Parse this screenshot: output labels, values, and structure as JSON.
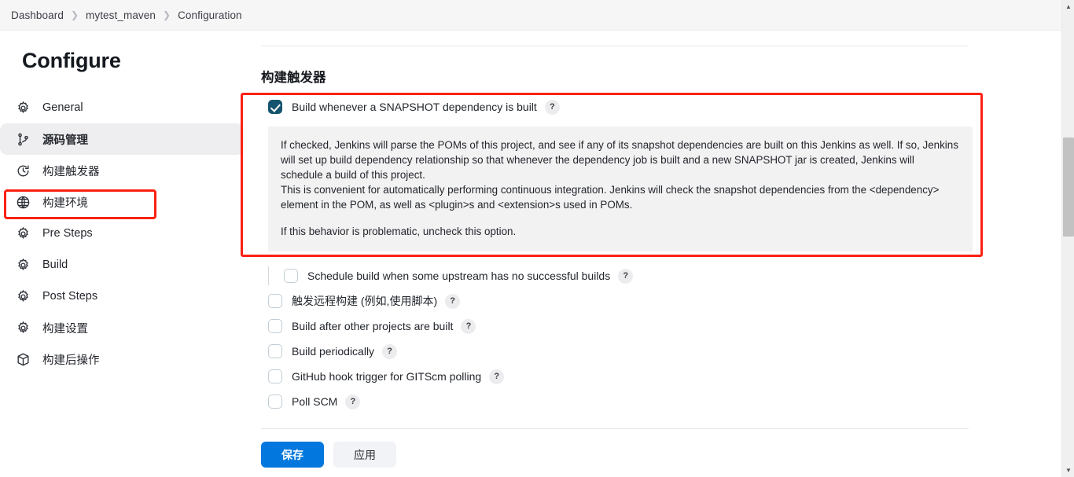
{
  "breadcrumb": {
    "items": [
      {
        "label": "Dashboard"
      },
      {
        "label": "mytest_maven"
      },
      {
        "label": "Configuration"
      }
    ],
    "separator": "❯"
  },
  "sidebar": {
    "title": "Configure",
    "items": [
      {
        "label": "General",
        "icon": "gear-icon",
        "active": false
      },
      {
        "label": "源码管理",
        "icon": "source-branch-icon",
        "active": true
      },
      {
        "label": "构建触发器",
        "icon": "clock-icon",
        "active": false
      },
      {
        "label": "构建环境",
        "icon": "globe-icon",
        "active": false
      },
      {
        "label": "Pre Steps",
        "icon": "gear-icon",
        "active": false
      },
      {
        "label": "Build",
        "icon": "gear-icon",
        "active": false
      },
      {
        "label": "Post Steps",
        "icon": "gear-icon",
        "active": false
      },
      {
        "label": "构建设置",
        "icon": "gear-icon",
        "active": false
      },
      {
        "label": "构建后操作",
        "icon": "box-icon",
        "active": false
      }
    ]
  },
  "main": {
    "section_title": "构建触发器",
    "primary_option": {
      "label": "Build whenever a SNAPSHOT dependency is built",
      "checked": true,
      "help": "?"
    },
    "description": {
      "paragraph1": "If checked, Jenkins will parse the POMs of this project, and see if any of its snapshot dependencies are built on this Jenkins as well. If so, Jenkins will set up build dependency relationship so that whenever the dependency job is built and a new SNAPSHOT jar is created, Jenkins will schedule a build of this project.",
      "paragraph2": "This is convenient for automatically performing continuous integration. Jenkins will check the snapshot dependencies from the <dependency> element in the POM, as well as <plugin>s and <extension>s used in POMs.",
      "paragraph3": "If this behavior is problematic, uncheck this option."
    },
    "options": [
      {
        "label": "Schedule build when some upstream has no successful builds",
        "checked": false,
        "indented": true,
        "help": "?"
      },
      {
        "label": "触发远程构建 (例如,使用脚本)",
        "checked": false,
        "indented": false,
        "help": "?"
      },
      {
        "label": "Build after other projects are built",
        "checked": false,
        "indented": false,
        "help": "?"
      },
      {
        "label": "Build periodically",
        "checked": false,
        "indented": false,
        "help": "?"
      },
      {
        "label": "GitHub hook trigger for GITScm polling",
        "checked": false,
        "indented": false,
        "help": "?"
      },
      {
        "label": "Poll SCM",
        "checked": false,
        "indented": false,
        "help": "?"
      }
    ],
    "buttons": {
      "save": "保存",
      "apply": "应用"
    }
  },
  "annotations": {
    "nav_highlight_color": "#fb2113",
    "block_highlight_color": "#fb2113"
  },
  "scrollbar": {
    "up_arrow": "▲",
    "down_arrow": "▼"
  },
  "colors": {
    "primary_button": "#0277dd",
    "checked_checkbox": "#15546e",
    "annotation_red": "#fb2113",
    "panel_gray": "#f2f2f3"
  }
}
